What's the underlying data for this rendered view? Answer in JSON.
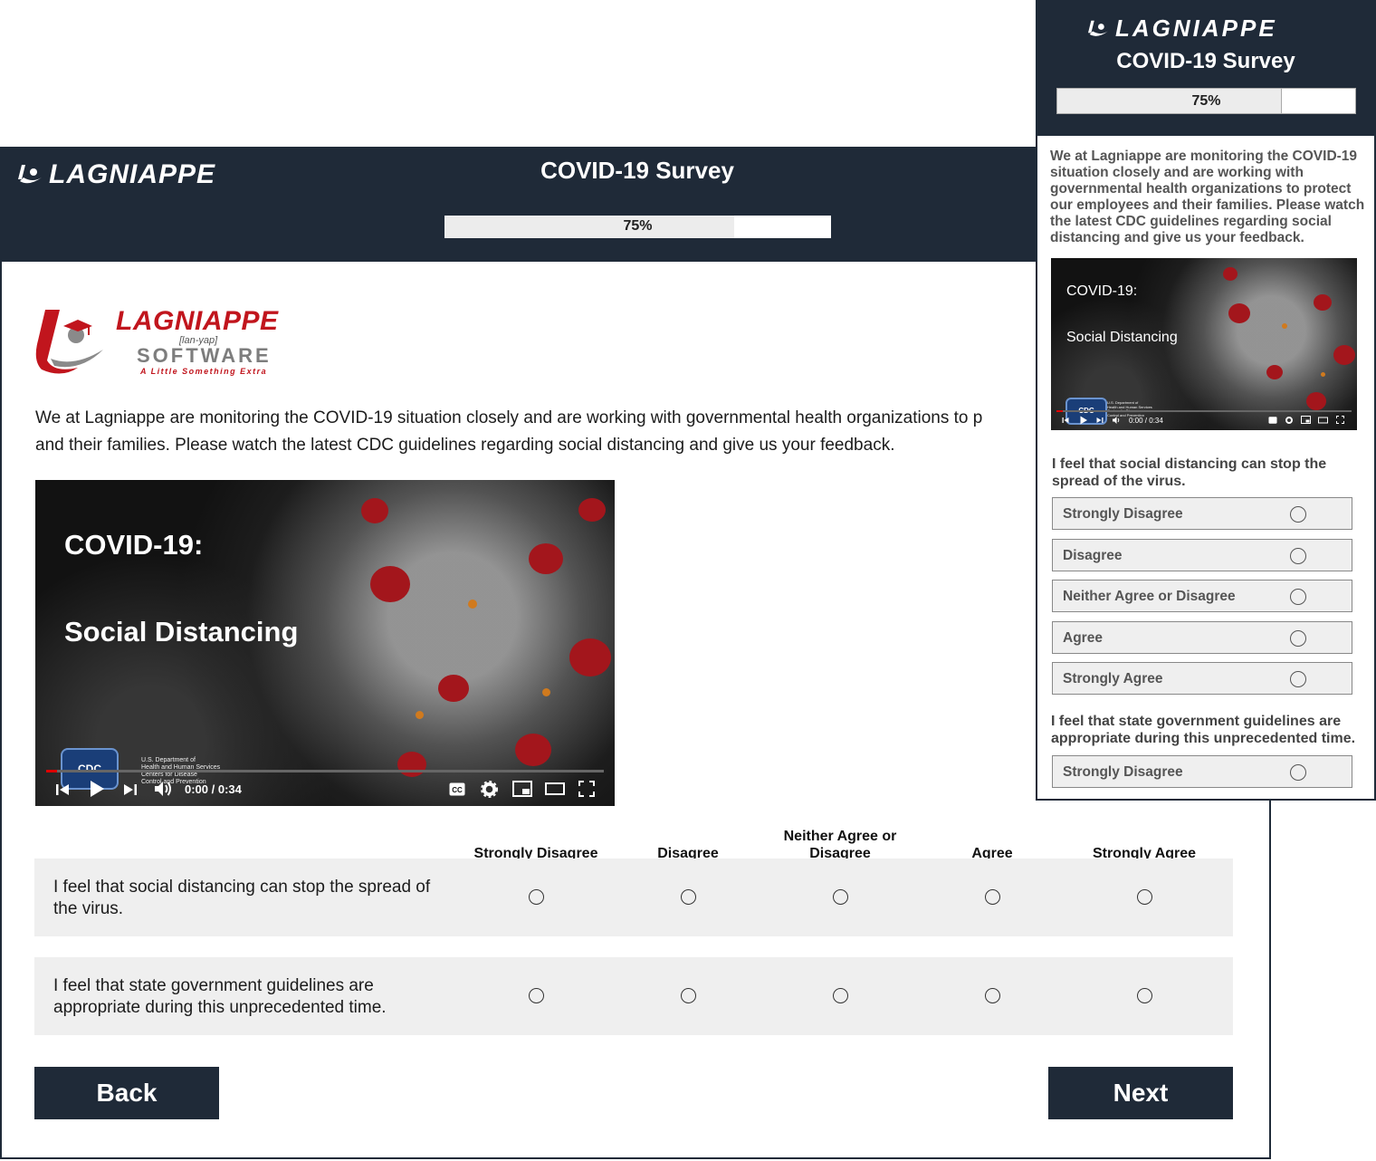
{
  "brand": {
    "wordmark": "LAGNIAPPE",
    "logo_name": "LAGNIAPPE",
    "logo_phonetic": "[lan-yap]",
    "logo_product": "SOFTWARE",
    "logo_tagline": "A Little Something Extra",
    "colors": {
      "navy": "#1f2a38",
      "brand_red": "#c1151d",
      "row_gray": "#efefef"
    }
  },
  "survey": {
    "title": "COVID-19 Survey",
    "progress_label": "75%",
    "progress_value": 0.75
  },
  "desktop": {
    "intro_line1": "We at Lagniappe are monitoring the COVID-19 situation closely and are working with governmental health organizations to p",
    "intro_line2": "and their families. Please watch the latest CDC guidelines regarding social distancing and give us your feedback.",
    "columns": [
      "Strongly Disagree",
      "Disagree",
      "Neither Agree or Disagree",
      "Agree",
      "Strongly Agree"
    ],
    "rows": [
      {
        "question": "I feel that social distancing can stop the spread of the virus."
      },
      {
        "question": "I feel that state government guidelines are appropriate during this unprecedented time."
      }
    ],
    "back_label": "Back",
    "next_label": "Next"
  },
  "video": {
    "title_line1": "COVID-19:",
    "title_line2": "Social Distancing",
    "badge": "CDC",
    "agency_lines": [
      "U.S. Department of",
      "Health and Human Services",
      "Centers for Disease",
      "Control and Prevention"
    ],
    "time": "0:00 / 0:34",
    "cc_label": "CC",
    "icons": [
      "skip-back-icon",
      "play-icon",
      "skip-forward-icon",
      "volume-icon",
      "captions-icon",
      "settings-icon",
      "miniplayer-icon",
      "theater-icon",
      "fullscreen-icon"
    ]
  },
  "mobile": {
    "intro_lines": [
      "We at Lagniappe are monitoring the COVID-19",
      "situation closely and are working with",
      "governmental health organizations to protect",
      "our employees and their families. Please watch",
      "the latest CDC guidelines regarding social",
      "distancing and give us your feedback."
    ],
    "q1": "I feel that social distancing can stop the spread of the virus.",
    "q1_options": [
      "Strongly Disagree",
      "Disagree",
      "Neither Agree or Disagree",
      "Agree",
      "Strongly Agree"
    ],
    "q2": "I feel that state government guidelines are appropriate during this unprecedented time.",
    "q2_options": [
      "Strongly Disagree"
    ]
  }
}
